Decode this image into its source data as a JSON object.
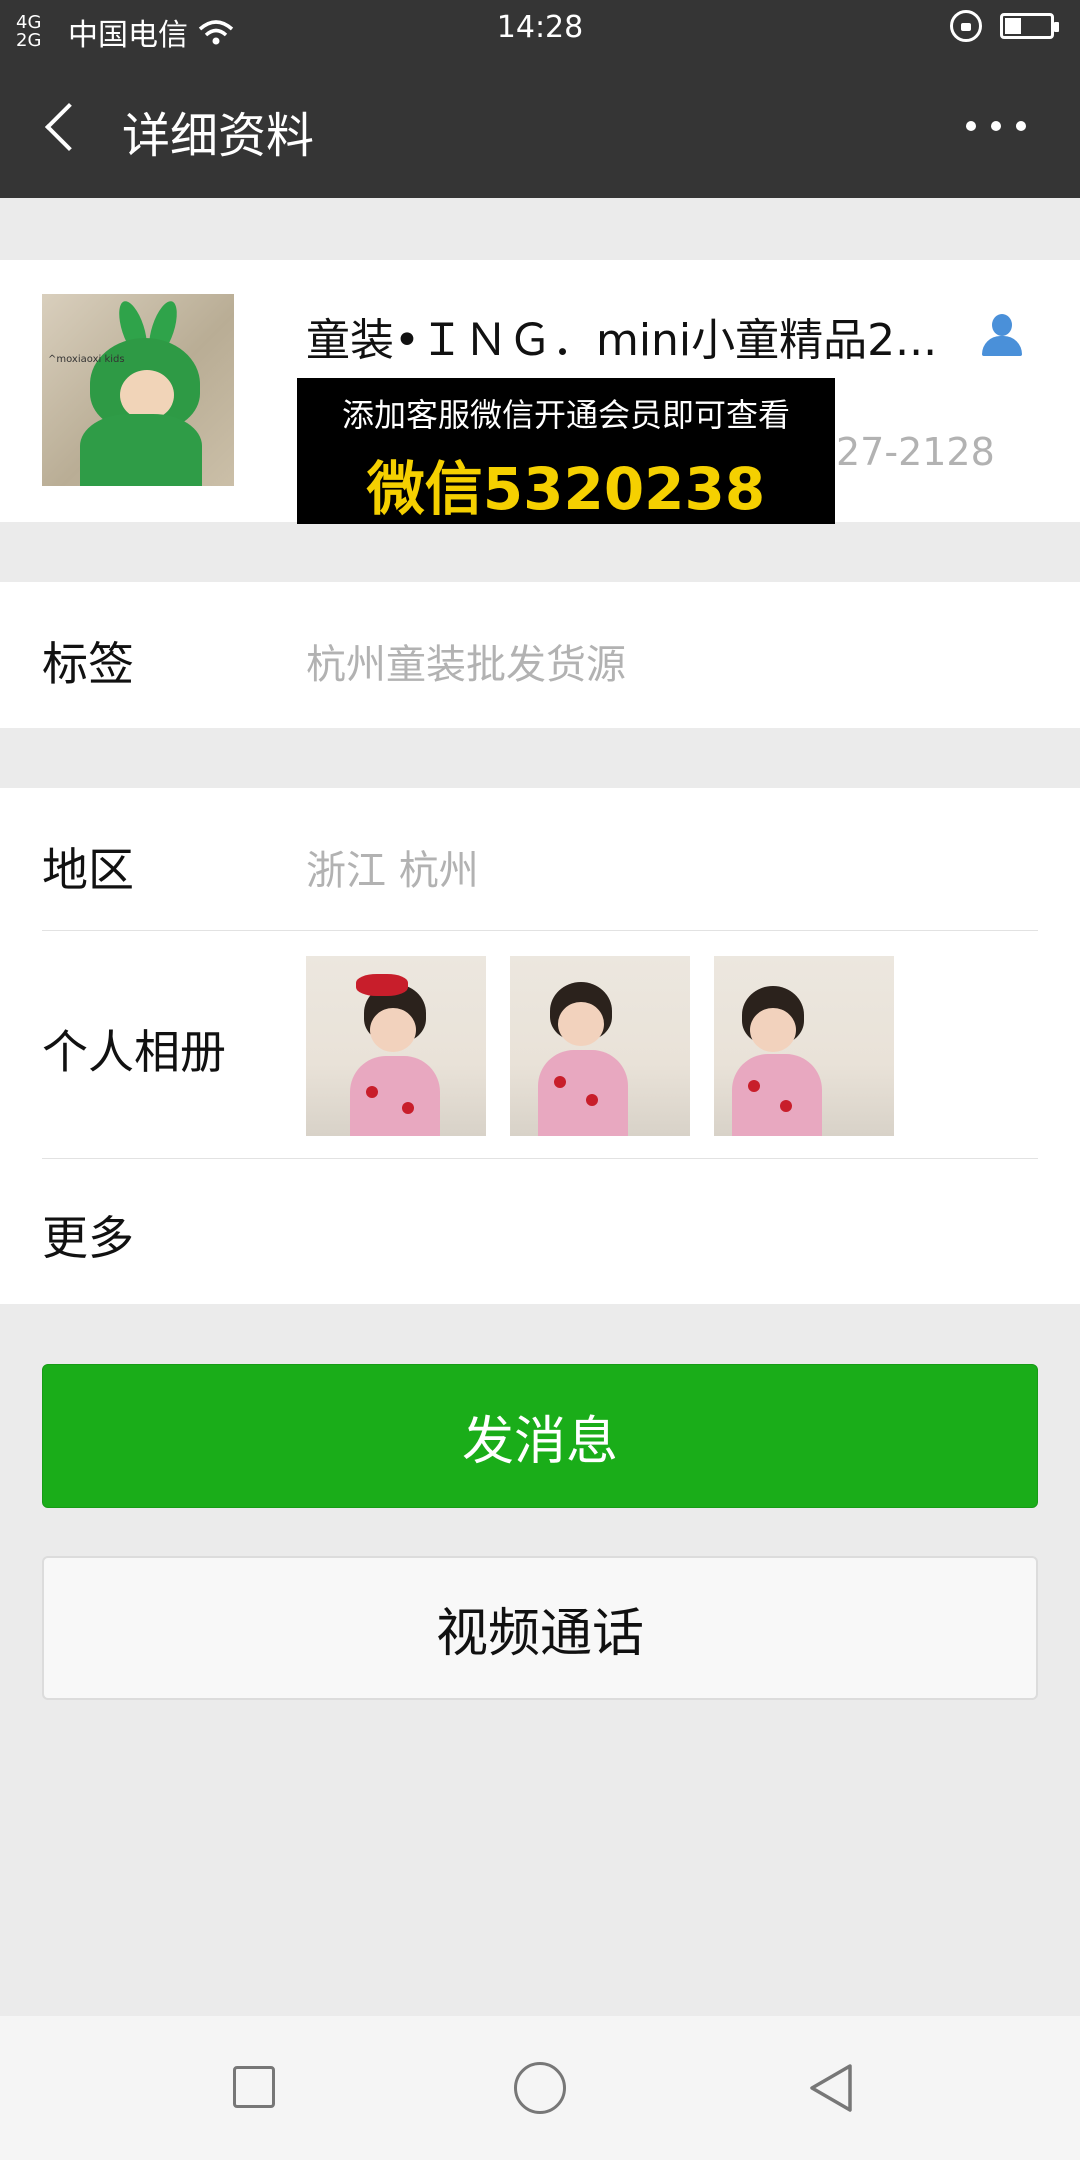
{
  "status_bar": {
    "network": "4G 2G",
    "carrier": "中国电信",
    "time": "14:28"
  },
  "header": {
    "title": "详细资料"
  },
  "profile": {
    "name": "童装•ＩＮＧ．mini小童精品2...",
    "wechat_id_partial": "27-2128",
    "avatar_text": "^moxiaoxi kids"
  },
  "promo_overlay": {
    "line1": "添加客服微信开通会员即可查看",
    "line2": "微信5320238"
  },
  "rows": {
    "tags_label": "标签",
    "tags_value": "杭州童装批发货源",
    "region_label": "地区",
    "region_value": "浙江  杭州",
    "album_label": "个人相册",
    "more_label": "更多"
  },
  "album_photos": [
    {
      "icon": "album-photo-1"
    },
    {
      "icon": "album-photo-2"
    },
    {
      "icon": "album-photo-3"
    }
  ],
  "buttons": {
    "send_message": "发消息",
    "video_call": "视频通话"
  },
  "colors": {
    "header_bg": "#353535",
    "primary_green": "#1aad19",
    "secondary_text": "#b2b2b2",
    "promo_yellow": "#f5d000"
  }
}
